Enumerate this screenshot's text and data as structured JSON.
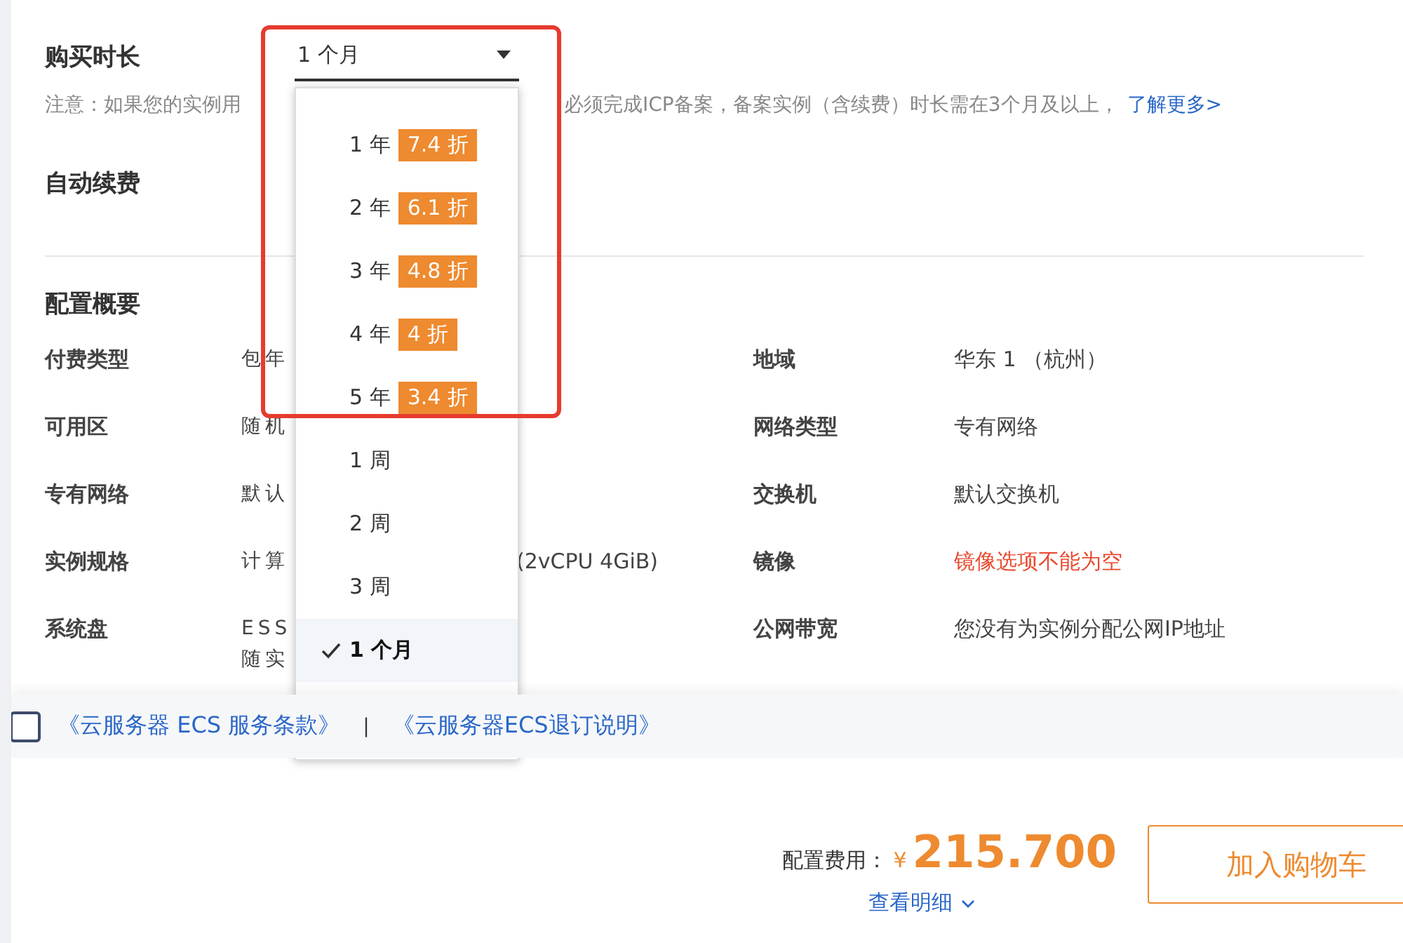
{
  "duration": {
    "label": "购买时长",
    "value": "1 个月",
    "note": "注意：如果您的实例用",
    "note_tail": "必须完成ICP备案，备案实例（含续费）时长需在3个月及以上，",
    "note_link": "了解更多>"
  },
  "auto_renew": {
    "label": "自动续费"
  },
  "summary": {
    "title": "配置概要",
    "rows": [
      {
        "label": "付费类型",
        "value": "包年",
        "label_right": "地域",
        "value_right": "华东 1 （杭州）"
      },
      {
        "label": "可用区",
        "value": "随机",
        "label_right": "网络类型",
        "value_right": "专有网络"
      },
      {
        "label": "专有网络",
        "value": "默认",
        "label_right": "交换机",
        "value_right": "默认交换机"
      },
      {
        "label": "实例规格",
        "value": "计算",
        "value_tail": "(2vCPU 4GiB)",
        "label_right": "镜像",
        "value_right": "镜像选项不能为空",
        "error_right": true
      },
      {
        "label": "系统盘",
        "value": "ESS",
        "value_line2": "随实",
        "label_right": "公网带宽",
        "value_right": "您没有为实例分配公网IP地址"
      }
    ]
  },
  "dropdown": {
    "annotation_frame": true,
    "options": [
      {
        "label": "1 年",
        "discount": "7.4 折",
        "selected": false
      },
      {
        "label": "2 年",
        "discount": "6.1 折",
        "selected": false
      },
      {
        "label": "3 年",
        "discount": "4.8 折",
        "selected": false
      },
      {
        "label": "4 年",
        "discount": "4 折",
        "selected": false
      },
      {
        "label": "5 年",
        "discount": "3.4 折",
        "selected": false
      },
      {
        "label": "1 周",
        "selected": false
      },
      {
        "label": "2 周",
        "selected": false
      },
      {
        "label": "3 周",
        "selected": false
      },
      {
        "label": "1 个月",
        "selected": true
      }
    ]
  },
  "agreement": {
    "checked": false,
    "links": [
      "《云服务器 ECS 服务条款》",
      "《云服务器ECS退订说明》"
    ],
    "separator": "|"
  },
  "footer": {
    "price_label": "配置费用：",
    "currency": "¥",
    "price": "215.700",
    "details_link": "查看明细",
    "button": "加入购物车"
  }
}
